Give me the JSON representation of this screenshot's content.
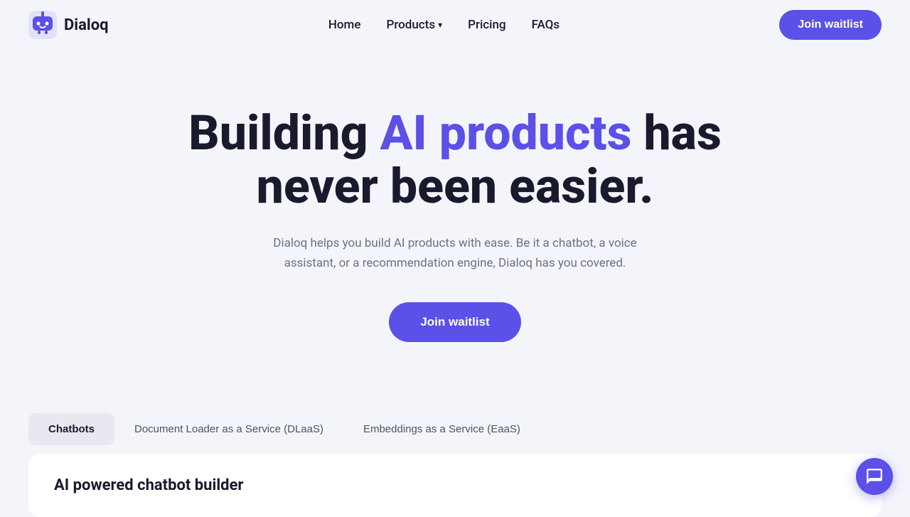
{
  "brand": {
    "name": "Dialoq",
    "logo_alt": "Dialoq logo"
  },
  "nav": {
    "home": "Home",
    "products": "Products",
    "pricing": "Pricing",
    "faqs": "FAQs",
    "join_waitlist": "Join waitlist"
  },
  "hero": {
    "title_part1": "Building ",
    "title_highlight": "AI products",
    "title_part2": " has never been easier.",
    "subtitle": "Dialoq helps you build AI products with ease. Be it a chatbot, a voice assistant, or a recommendation engine, Dialoq has you covered.",
    "cta_label": "Join waitlist"
  },
  "tabs": [
    {
      "id": "chatbots",
      "label": "Chatbots",
      "active": true
    },
    {
      "id": "dlaas",
      "label": "Document Loader as a Service (DLaaS)",
      "active": false
    },
    {
      "id": "eaas",
      "label": "Embeddings as a Service (EaaS)",
      "active": false
    }
  ],
  "content": {
    "active_tab_title": "AI powered chatbot builder"
  }
}
